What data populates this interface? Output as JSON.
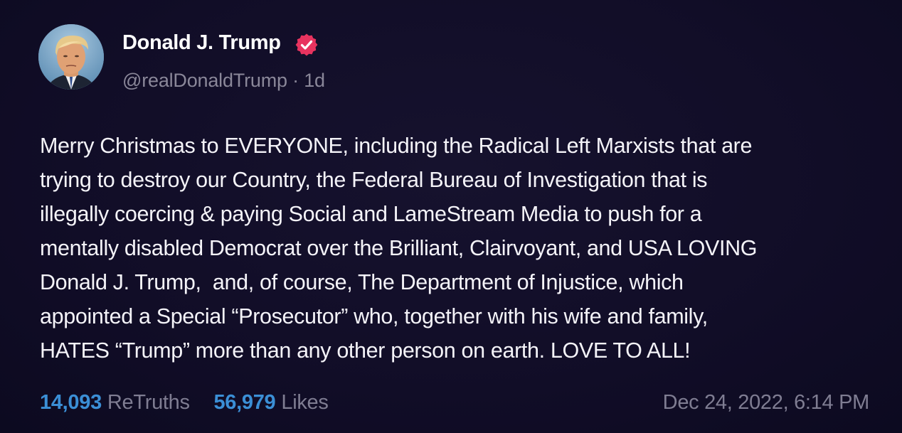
{
  "author": {
    "display_name": "Donald J. Trump",
    "handle": "@realDonaldTrump",
    "separator": "·",
    "relative_time": "1d",
    "verified_icon": "verified-badge-icon",
    "verified_color": "#e8335f"
  },
  "post": {
    "lines": [
      "Merry Christmas to EVERYONE, including the Radical Left Marxists that are",
      "trying to destroy our Country, the Federal Bureau of Investigation that is",
      "illegally coercing & paying Social and LameStream Media to push for a",
      "mentally disabled Democrat over the Brilliant, Clairvoyant, and USA LOVING",
      "Donald J. Trump,  and, of course, The Department of Injustice, which",
      "appointed a Special “Prosecutor” who, together with his wife and family,",
      "HATES “Trump” more than any other person on earth. LOVE TO ALL!"
    ]
  },
  "stats": {
    "retruths_count": "14,093",
    "retruths_label": "ReTruths",
    "likes_count": "56,979",
    "likes_label": "Likes",
    "count_color": "#3b8fd6"
  },
  "timestamp": "Dec 24, 2022, 6:14 PM",
  "colors": {
    "background": "#110d27",
    "text": "#f4f3f8",
    "muted": "#7f7d92"
  }
}
